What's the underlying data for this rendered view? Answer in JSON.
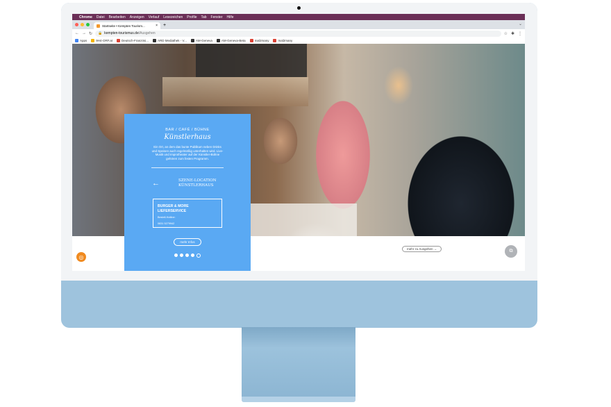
{
  "menubar": {
    "apple": "",
    "items": [
      "Chrome",
      "Datei",
      "Bearbeiten",
      "Anzeigen",
      "Verlauf",
      "Lesezeichen",
      "Profile",
      "Tab",
      "Fenster",
      "Hilfe"
    ]
  },
  "tab": {
    "title": "Startseite • Kempten Tourism...",
    "close": "×",
    "new": "+",
    "menu": "⌄"
  },
  "toolbar": {
    "back": "←",
    "forward": "→",
    "reload": "↻",
    "lock": "🔒",
    "domain": "kempten-tourismus.de",
    "path": "/Ausgehen",
    "star": "☆",
    "ext": "✱",
    "menu": "⋮"
  },
  "bookmarks": [
    {
      "label": "Apps",
      "color": "#4285f4"
    },
    {
      "label": "9H4-ORF.at",
      "color": "#f4b400"
    },
    {
      "label": "Deutsch-Französi...",
      "color": "#db4437"
    },
    {
      "label": "ARD Mediathek - V...",
      "color": "#333333"
    },
    {
      "label": "AM-Geneva",
      "color": "#333333"
    },
    {
      "label": "AM-Geneva-Beta",
      "color": "#333333"
    },
    {
      "label": "mal2many",
      "color": "#db4437"
    },
    {
      "label": "mal2many",
      "color": "#db4437"
    }
  ],
  "panel": {
    "kicker": "BAR / CAFÉ / BÜHNE",
    "script": "Künstlerhaus",
    "desc": "Ein Ort, an dem das bunte Publikum neben Drinks und Speisen auch regelmäßig unterhalten wird. Live-Musik und Improtheater auf der Künstler-Bühne gehören zum festen Programm.",
    "arrow": "←",
    "loc_line1": "SZENE-LOCATION",
    "loc_line2": "KÜNSTLERHAUS",
    "box_line1": "BURGER & MORE",
    "box_line2": "LIEFERSERVICE",
    "box_detail1": "Bestell-Hotline:",
    "box_detail2": "0831 5279942",
    "more": "mehr Infos"
  },
  "slider": {
    "total": 5,
    "active": 4
  },
  "out_btn": "mehr zu Ausgehen →",
  "fab_icon": "⧉",
  "logo_icon": "◎"
}
